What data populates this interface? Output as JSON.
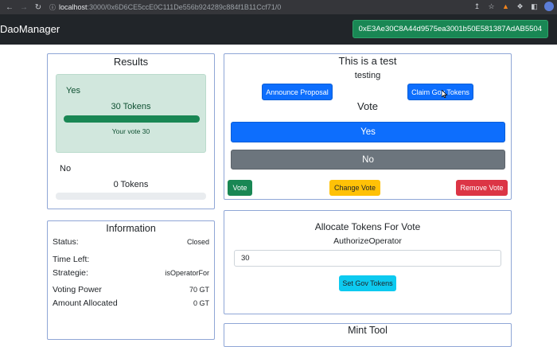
{
  "browser": {
    "host": "localhost",
    "path": ":3000/0x6D6CE5ccE0C111De556b924289c884f1B11Ccf71/0"
  },
  "navbar": {
    "brand": "DaoManager",
    "account": "0xE3Ae30C8A44d9575ea3001b50E581387AdAB5504"
  },
  "results": {
    "title": "Results",
    "yes": {
      "label": "Yes",
      "tokens": "30 Tokens",
      "your_vote": "Your vote 30",
      "progress_pct": 100
    },
    "no": {
      "label": "No",
      "tokens": "0 Tokens",
      "progress_pct": 0
    }
  },
  "info": {
    "title": "Information",
    "rows": [
      {
        "key": "Status:",
        "value": "Closed"
      },
      {
        "key": "Time Left:",
        "value": ""
      },
      {
        "key": "Strategie:",
        "value": "isOperatorFor"
      },
      {
        "key": "Voting Power",
        "value": "70 GT"
      },
      {
        "key": "Amount Allocated",
        "value": "0 GT"
      }
    ]
  },
  "proposal": {
    "title": "This is a test",
    "description": "testing",
    "announce_label": "Announce Proposal",
    "claim_label": "Claim Gov Tokens",
    "vote_heading": "Vote",
    "yes_option": "Yes",
    "no_option": "No",
    "vote_button": "Vote",
    "change_vote_button": "Change Vote",
    "remove_vote_button": "Remove Vote"
  },
  "allocate": {
    "title": "Allocate Tokens For Vote",
    "subtitle": "AuthorizeOperator",
    "amount_value": "30",
    "submit_label": "Set Gov Tokens"
  },
  "mint": {
    "title": "Mint Tool"
  },
  "colors": {
    "success": "#198754",
    "primary": "#0d6efd",
    "secondary": "#6c757d",
    "warning": "#ffc107",
    "danger": "#dc3545",
    "info": "#0dcaf0",
    "navbar": "#212529"
  }
}
